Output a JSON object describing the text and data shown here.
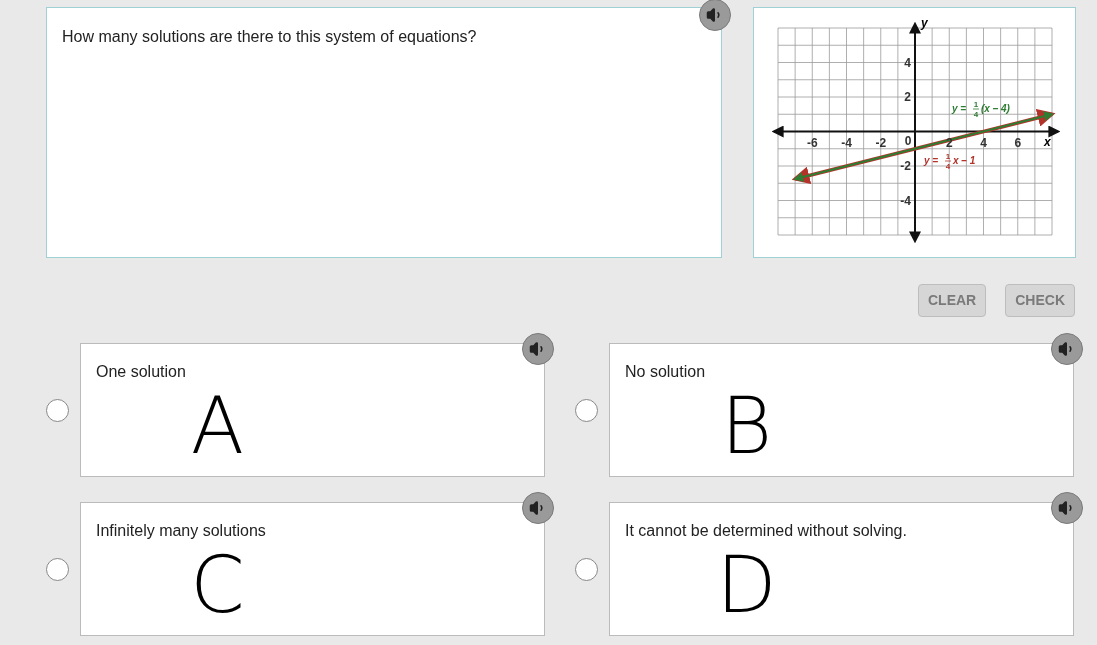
{
  "question": {
    "text": "How many solutions are there to this system of equations?"
  },
  "graph": {
    "chart_data": {
      "type": "line",
      "xlabel": "x",
      "ylabel": "y",
      "x": [
        -7,
        8
      ],
      "xlim": [
        -8,
        8
      ],
      "ylim": [
        -6,
        6
      ],
      "xticks": [
        -6,
        -4,
        -2,
        2,
        4,
        6
      ],
      "yticks": [
        -4,
        -2,
        2,
        4
      ],
      "series": [
        {
          "color": "#b3322a",
          "values": [
            -2.75,
            1
          ]
        },
        {
          "color": "#2e7d32",
          "values": [
            -2.75,
            1
          ]
        }
      ],
      "grid": true
    },
    "equation_labels": [
      {
        "color": "#2e7d32",
        "before": "y =",
        "numerator": "1",
        "denominator": "4",
        "after": "(x – 4)"
      },
      {
        "color": "#b3322a",
        "before": "y =",
        "numerator": "1",
        "denominator": "4",
        "after": "x – 1"
      }
    ],
    "origin_label": "0"
  },
  "buttons": [
    {
      "label": "CLEAR",
      "disabled": true
    },
    {
      "label": "CHECK",
      "disabled": true
    }
  ],
  "choices": [
    {
      "text": "One solution",
      "sketch": "A",
      "selected": false
    },
    {
      "text": "No solution",
      "sketch": "B",
      "selected": false
    },
    {
      "text": "Infinitely many solutions",
      "sketch": "C",
      "selected": false
    },
    {
      "text": "It cannot be determined without solving.",
      "sketch": "D",
      "selected": false
    }
  ]
}
